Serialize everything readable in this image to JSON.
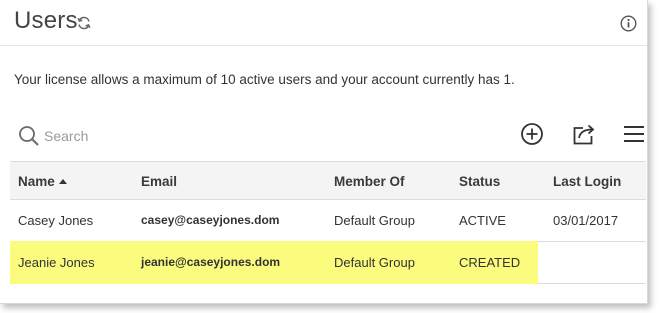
{
  "header": {
    "title": "Users",
    "icons": [
      "refresh-icon",
      "info-icon"
    ]
  },
  "license_text": "Your license allows a maximum of 10 active users and your account currently has 1.",
  "toolbar": {
    "search_placeholder": "Search",
    "icons": [
      "search-icon",
      "add-icon",
      "export-icon",
      "menu-icon"
    ]
  },
  "table": {
    "columns": [
      "Name",
      "Email",
      "Member Of",
      "Status",
      "Last Login"
    ],
    "sorted_column": "Name",
    "sort_direction": "ascending",
    "rows": [
      {
        "name": "Casey Jones",
        "email": "casey@caseyjones.dom",
        "member_of": "Default Group",
        "status": "ACTIVE",
        "last_login": "03/01/2017",
        "highlighted": false
      },
      {
        "name": "Jeanie Jones",
        "email": "jeanie@caseyjones.dom",
        "member_of": "Default Group",
        "status": "CREATED",
        "last_login": "",
        "highlighted": true
      }
    ]
  },
  "colors": {
    "highlight": "#fbfb7e",
    "header_bg": "#f4f4f4",
    "border": "#dcdcdc"
  }
}
